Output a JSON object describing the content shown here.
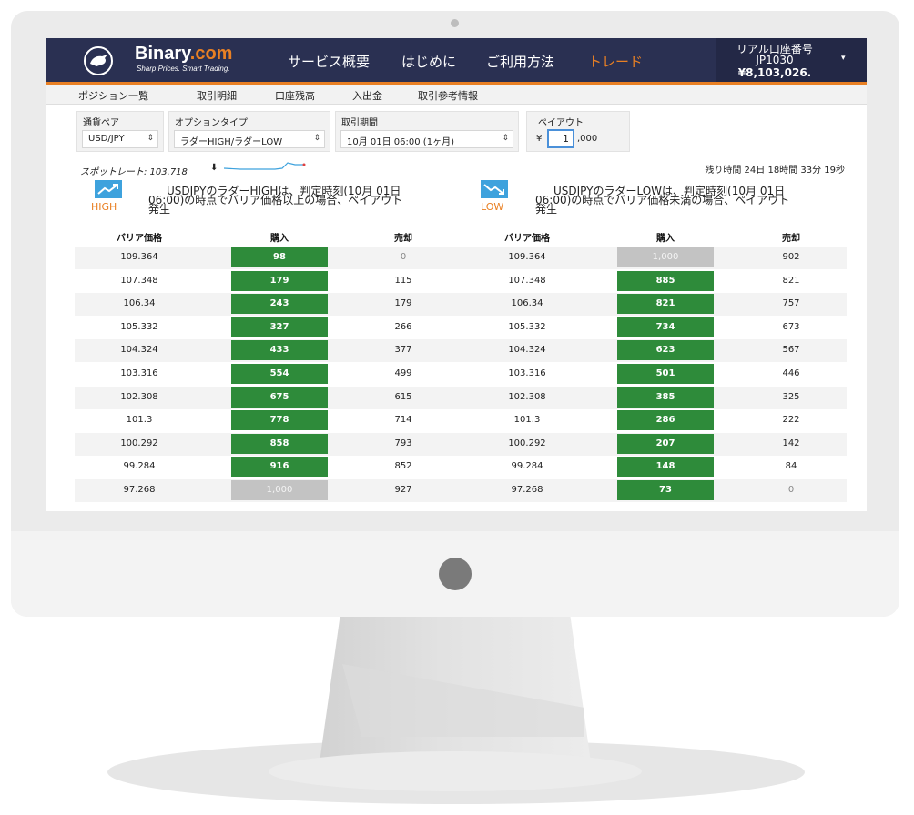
{
  "brand": {
    "name_main": "Binary",
    "name_tld": ".com",
    "tagline": "Sharp Prices. Smart Trading."
  },
  "nav": {
    "items": [
      {
        "label": "サービス概要"
      },
      {
        "label": "はじめに"
      },
      {
        "label": "ご利用方法"
      },
      {
        "label": "トレード",
        "active": true
      }
    ]
  },
  "account": {
    "label": "リアル口座番号",
    "id": "JP1030",
    "balance": "¥8,103,026."
  },
  "subnav": {
    "items": [
      {
        "label": "ポジション一覧"
      },
      {
        "label": "取引明細"
      },
      {
        "label": "口座残高"
      },
      {
        "label": "入出金"
      },
      {
        "label": "取引参考情報"
      }
    ]
  },
  "controls": {
    "pair": {
      "label": "通貨ペア",
      "value": "USD/JPY"
    },
    "option_type": {
      "label": "オプションタイプ",
      "value": "ラダーHIGH/ラダーLOW"
    },
    "period": {
      "label": "取引期間",
      "value": "10月 01日 06:00 (1ヶ月)"
    },
    "payout": {
      "label": "ペイアウト",
      "currency": "¥",
      "value": "1",
      "suffix": ",000"
    }
  },
  "spot": {
    "label": "スポットレート: 103.718",
    "arrow": "⬇"
  },
  "remaining_time": "残り時間 24日 18時間 33分 19秒",
  "contracts": {
    "high": {
      "tag": "HIGH",
      "desc_line1": "USDJPYのラダーHIGHは、判定時刻(10月 01日",
      "desc_line2": "06:00)の時点でバリア価格以上の場合、ペイアウト",
      "desc_line3": "発生"
    },
    "low": {
      "tag": "LOW",
      "desc_line1": "USDJPYのラダーLOWは、判定時刻(10月 01日",
      "desc_line2": "06:00)の時点でバリア価格未満の場合、ペイアウト",
      "desc_line3": "発生"
    }
  },
  "table": {
    "headers": {
      "barrier": "バリア価格",
      "buy": "購入",
      "sell": "売却"
    },
    "rows": [
      {
        "barrier": "109.364",
        "high_buy": "98",
        "high_buy_disabled": false,
        "high_sell": "0",
        "low_buy": "1,000",
        "low_buy_disabled": true,
        "low_sell": "902"
      },
      {
        "barrier": "107.348",
        "high_buy": "179",
        "high_buy_disabled": false,
        "high_sell": "115",
        "low_buy": "885",
        "low_buy_disabled": false,
        "low_sell": "821"
      },
      {
        "barrier": "106.34",
        "high_buy": "243",
        "high_buy_disabled": false,
        "high_sell": "179",
        "low_buy": "821",
        "low_buy_disabled": false,
        "low_sell": "757"
      },
      {
        "barrier": "105.332",
        "high_buy": "327",
        "high_buy_disabled": false,
        "high_sell": "266",
        "low_buy": "734",
        "low_buy_disabled": false,
        "low_sell": "673"
      },
      {
        "barrier": "104.324",
        "high_buy": "433",
        "high_buy_disabled": false,
        "high_sell": "377",
        "low_buy": "623",
        "low_buy_disabled": false,
        "low_sell": "567"
      },
      {
        "barrier": "103.316",
        "high_buy": "554",
        "high_buy_disabled": false,
        "high_sell": "499",
        "low_buy": "501",
        "low_buy_disabled": false,
        "low_sell": "446"
      },
      {
        "barrier": "102.308",
        "high_buy": "675",
        "high_buy_disabled": false,
        "high_sell": "615",
        "low_buy": "385",
        "low_buy_disabled": false,
        "low_sell": "325"
      },
      {
        "barrier": "101.3",
        "high_buy": "778",
        "high_buy_disabled": false,
        "high_sell": "714",
        "low_buy": "286",
        "low_buy_disabled": false,
        "low_sell": "222"
      },
      {
        "barrier": "100.292",
        "high_buy": "858",
        "high_buy_disabled": false,
        "high_sell": "793",
        "low_buy": "207",
        "low_buy_disabled": false,
        "low_sell": "142"
      },
      {
        "barrier": "99.284",
        "high_buy": "916",
        "high_buy_disabled": false,
        "high_sell": "852",
        "low_buy": "148",
        "low_buy_disabled": false,
        "low_sell": "84"
      },
      {
        "barrier": "97.268",
        "high_buy": "1,000",
        "high_buy_disabled": true,
        "high_sell": "927",
        "low_buy": "73",
        "low_buy_disabled": false,
        "low_sell": "0"
      }
    ]
  },
  "colors": {
    "header_bg": "#2a3052",
    "accent_orange": "#e98024",
    "buy_green": "#2e8b3a",
    "disabled_gray": "#c3c3c3",
    "contract_icon_blue": "#3ea2dd"
  }
}
